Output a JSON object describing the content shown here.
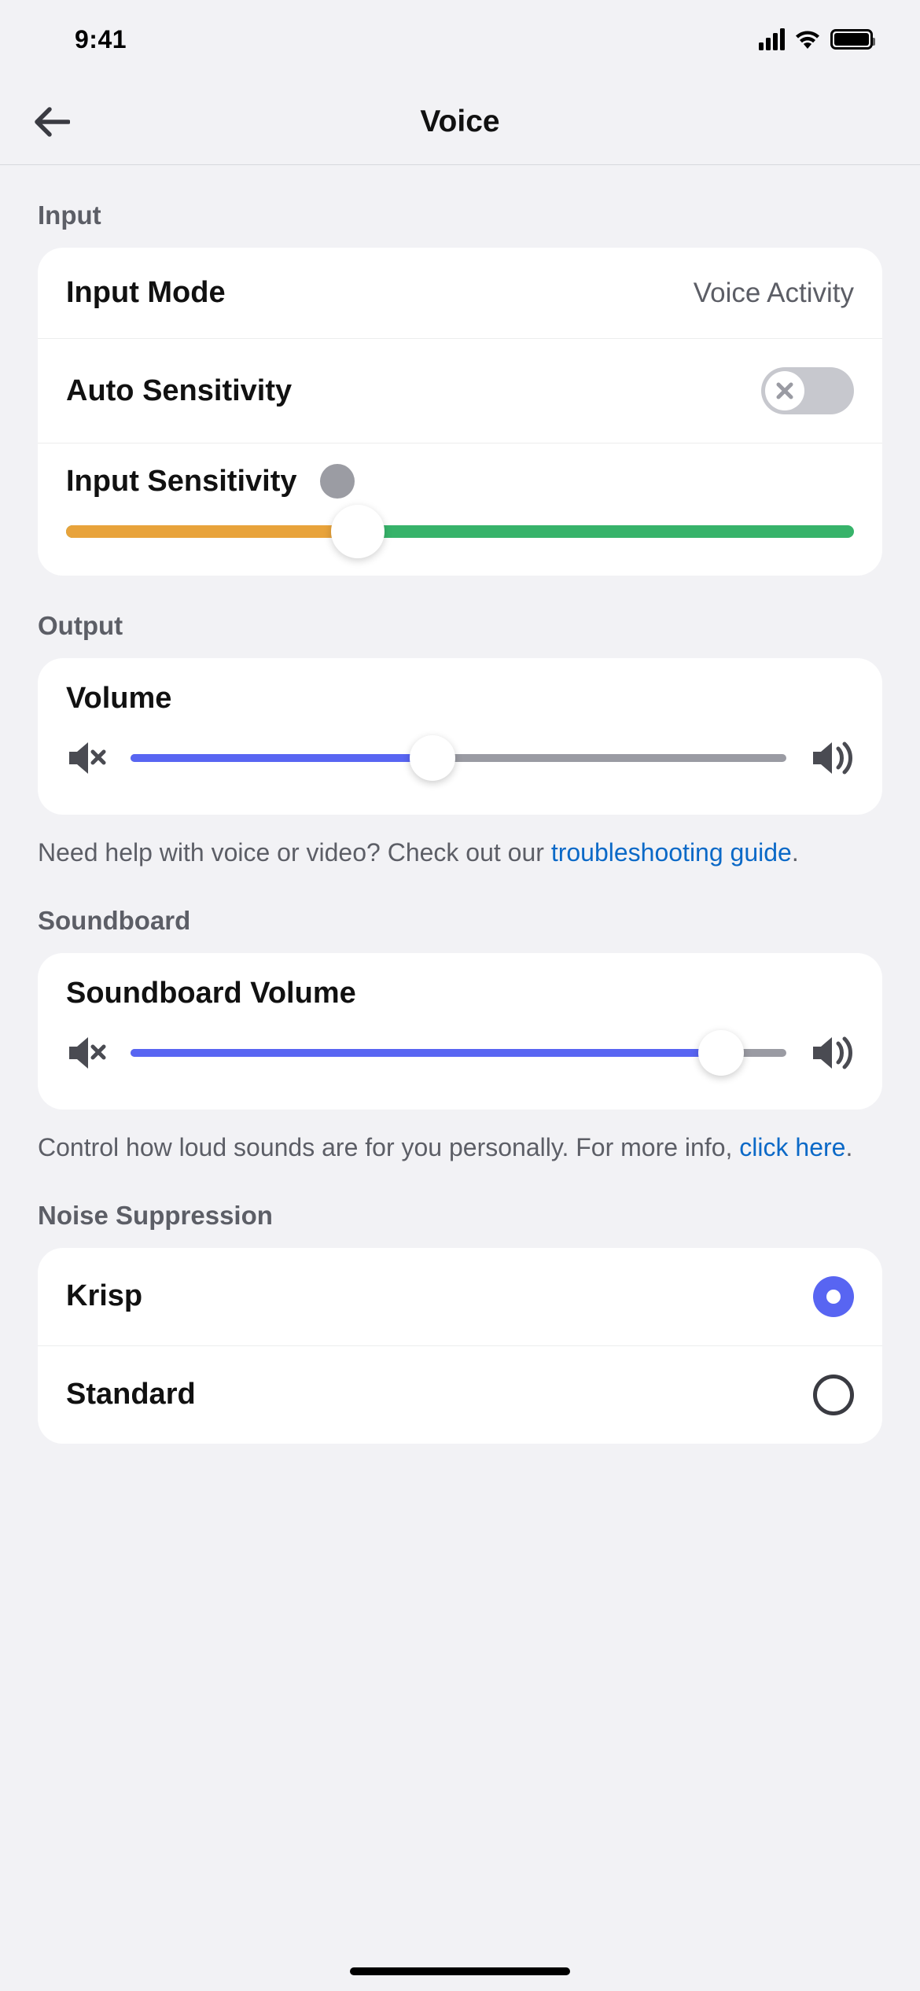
{
  "status": {
    "time": "9:41"
  },
  "nav": {
    "title": "Voice"
  },
  "sections": {
    "input": {
      "heading": "Input",
      "input_mode": {
        "label": "Input Mode",
        "value": "Voice Activity"
      },
      "auto_sensitivity": {
        "label": "Auto Sensitivity",
        "enabled": false
      },
      "input_sensitivity": {
        "label": "Input Sensitivity",
        "value_percent": 37
      }
    },
    "output": {
      "heading": "Output",
      "volume": {
        "label": "Volume",
        "value_percent": 46
      },
      "helper_prefix": "Need help with voice or video? Check out our ",
      "helper_link": "troubleshooting guide",
      "helper_suffix": "."
    },
    "soundboard": {
      "heading": "Soundboard",
      "volume": {
        "label": "Soundboard Volume",
        "value_percent": 90
      },
      "helper_prefix": "Control how loud sounds are for you personally. For more info, ",
      "helper_link": "click here",
      "helper_suffix": "."
    },
    "noise": {
      "heading": "Noise Suppression",
      "options": [
        {
          "label": "Krisp",
          "selected": true
        },
        {
          "label": "Standard",
          "selected": false
        }
      ]
    }
  }
}
